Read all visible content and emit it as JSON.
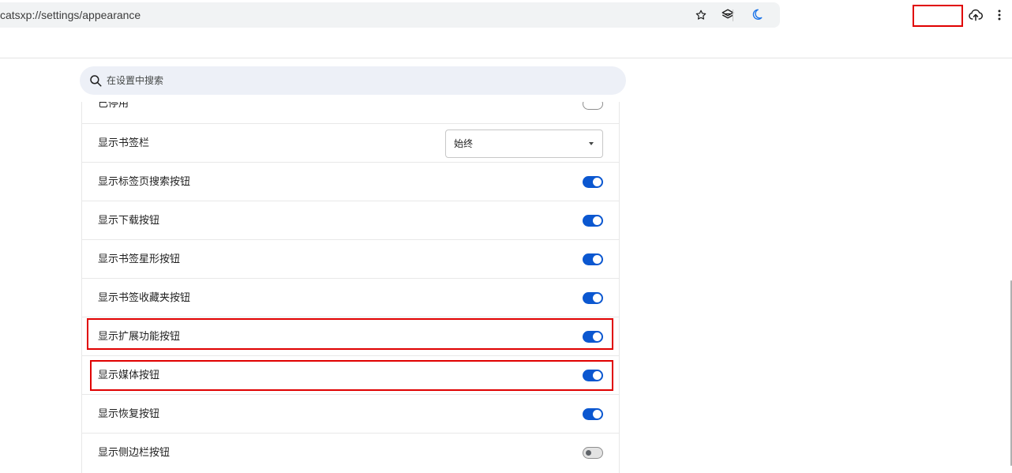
{
  "address_bar": {
    "url": "catsxp://settings/appearance"
  },
  "icons": {
    "bookmark_star": "star-icon",
    "tab_search": "layers-icon",
    "dark_mode": "moon-icon",
    "upload": "cloud-upload-icon",
    "menu": "more-vert-icon"
  },
  "search": {
    "placeholder": "在设置中搜索"
  },
  "settings": {
    "partial_row_label": "已停用",
    "rows": [
      {
        "label": "显示书签栏",
        "control": "select",
        "value": "始终"
      },
      {
        "label": "显示标签页搜索按钮",
        "control": "toggle",
        "on": true
      },
      {
        "label": "显示下载按钮",
        "control": "toggle",
        "on": true
      },
      {
        "label": "显示书签星形按钮",
        "control": "toggle",
        "on": true
      },
      {
        "label": "显示书签收藏夹按钮",
        "control": "toggle",
        "on": true
      },
      {
        "label": "显示扩展功能按钮",
        "control": "toggle",
        "on": true
      },
      {
        "label": "显示媒体按钮",
        "control": "toggle",
        "on": true
      },
      {
        "label": "显示恢复按钮",
        "control": "toggle",
        "on": true
      },
      {
        "label": "显示侧边栏按钮",
        "control": "toggle",
        "on": false
      }
    ]
  },
  "colors": {
    "accent": "#0b57d0",
    "highlight": "#e00000",
    "search_bg": "#edf0f7"
  }
}
